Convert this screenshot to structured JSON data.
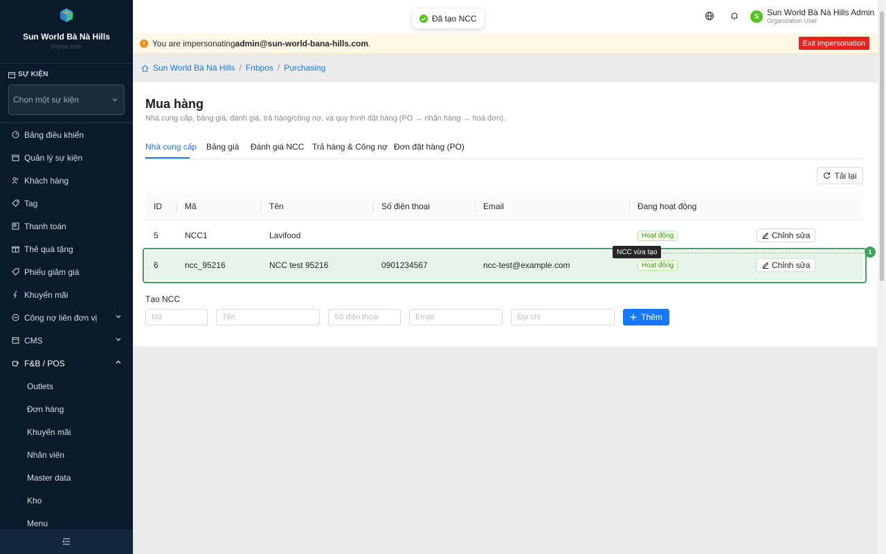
{
  "brand": {
    "name": "Sun World Bà Nà Hills",
    "sub": "Ortrex.com"
  },
  "sidebar": {
    "event_label": "SỰ KIỆN",
    "event_placeholder": "Chọn một sự kiện",
    "items": [
      {
        "label": "Bảng điều khiển",
        "icon": "dashboard-icon"
      },
      {
        "label": "Quản lý sự kiện",
        "icon": "calendar-icon"
      },
      {
        "label": "Khách hàng",
        "icon": "users-icon"
      },
      {
        "label": "Tag",
        "icon": "tag-icon"
      },
      {
        "label": "Thanh toán",
        "icon": "payment-icon"
      },
      {
        "label": "Thẻ quà tặng",
        "icon": "gift-icon"
      },
      {
        "label": "Phiếu giảm giá",
        "icon": "coupon-icon"
      },
      {
        "label": "Khuyến mãi",
        "icon": "flash-icon"
      },
      {
        "label": "Công nợ liên đơn vị",
        "icon": "debt-icon"
      },
      {
        "label": "CMS",
        "icon": "cms-icon"
      },
      {
        "label": "F&B / POS",
        "icon": "coffee-icon"
      }
    ],
    "subitems": [
      "Outlets",
      "Đơn hàng",
      "Khuyến mãi",
      "Nhân viên",
      "Master data",
      "Kho",
      "Menu"
    ]
  },
  "toast": {
    "text": "Đã tạo NCC"
  },
  "user": {
    "initial": "S",
    "name": "Sun World Bà Nà Hills Admin",
    "role": "Organization User"
  },
  "banner": {
    "prefix": "You are impersonating ",
    "email": "admin@sun-world-bana-hills.com",
    "suffix": ".",
    "exit_label": "Exit impersonation"
  },
  "breadcrumb": [
    "Sun World Bà Nà Hills",
    "Fnbpos",
    "Purchasing"
  ],
  "page": {
    "title": "Mua hàng",
    "subtitle": "Nhà cung cấp, bảng giá, đánh giá, trả hàng/công nợ, và quy trình đặt hàng (PO → nhận hàng → hoá đơn)."
  },
  "tabs": [
    "Nhà cung cấp",
    "Bảng giá",
    "Đánh giá NCC",
    "Trả hàng & Công nợ",
    "Đơn đặt hàng (PO)"
  ],
  "reload_label": "Tải lại",
  "table": {
    "headers": [
      "ID",
      "Mã",
      "Tên",
      "Số điện thoại",
      "Email",
      "Đang hoạt động"
    ],
    "rows": [
      {
        "id": "5",
        "code": "NCC1",
        "name": "Lavifood",
        "phone": "",
        "email": "",
        "status": "Hoạt động",
        "action": "Chỉnh sửa"
      },
      {
        "id": "6",
        "code": "ncc_95216",
        "name": "NCC test 95216",
        "phone": "0901234567",
        "email": "ncc-test@example.com",
        "status": "Hoạt động",
        "action": "Chỉnh sửa"
      }
    ]
  },
  "highlight": {
    "tooltip": "NCC vừa tạo",
    "badge": "1"
  },
  "create": {
    "label": "Tạo NCC",
    "placeholders": {
      "code": "Mã",
      "name": "Tên",
      "phone": "Số điện thoại",
      "email": "Email",
      "address": "Địa chỉ"
    },
    "add_label": "Thêm"
  },
  "colors": {
    "sidebar_bg": "#0b1a2b",
    "primary": "#1677ff",
    "success": "#52c41a",
    "danger": "#e8231d",
    "highlight": "#3da35d"
  }
}
